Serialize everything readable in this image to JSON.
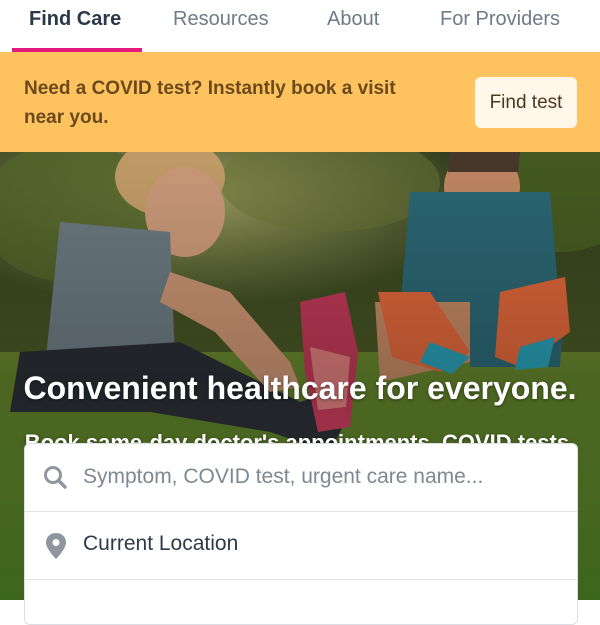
{
  "nav": {
    "tabs": [
      {
        "label": "Find Care",
        "active": true
      },
      {
        "label": "Resources",
        "active": false
      },
      {
        "label": "About",
        "active": false
      },
      {
        "label": "For Providers",
        "active": false
      }
    ]
  },
  "banner": {
    "text": "Need a COVID test? Instantly book a visit near you.",
    "button_label": "Find test"
  },
  "hero": {
    "title": "Convenient healthcare for everyone.",
    "subtitle": "Book same-day doctor's appointments, COVID tests, and video visits."
  },
  "search": {
    "query_placeholder": "Symptom, COVID test, urgent care name...",
    "query_value": "",
    "location_value": "Current Location",
    "icons": {
      "query": "search-icon",
      "location": "location-pin-icon"
    }
  },
  "colors": {
    "accent": "#e6197d",
    "banner_bg": "#fec25f",
    "banner_text": "#6b4a1c",
    "tab_active": "#29394a",
    "tab_inactive": "#6f7b86"
  }
}
